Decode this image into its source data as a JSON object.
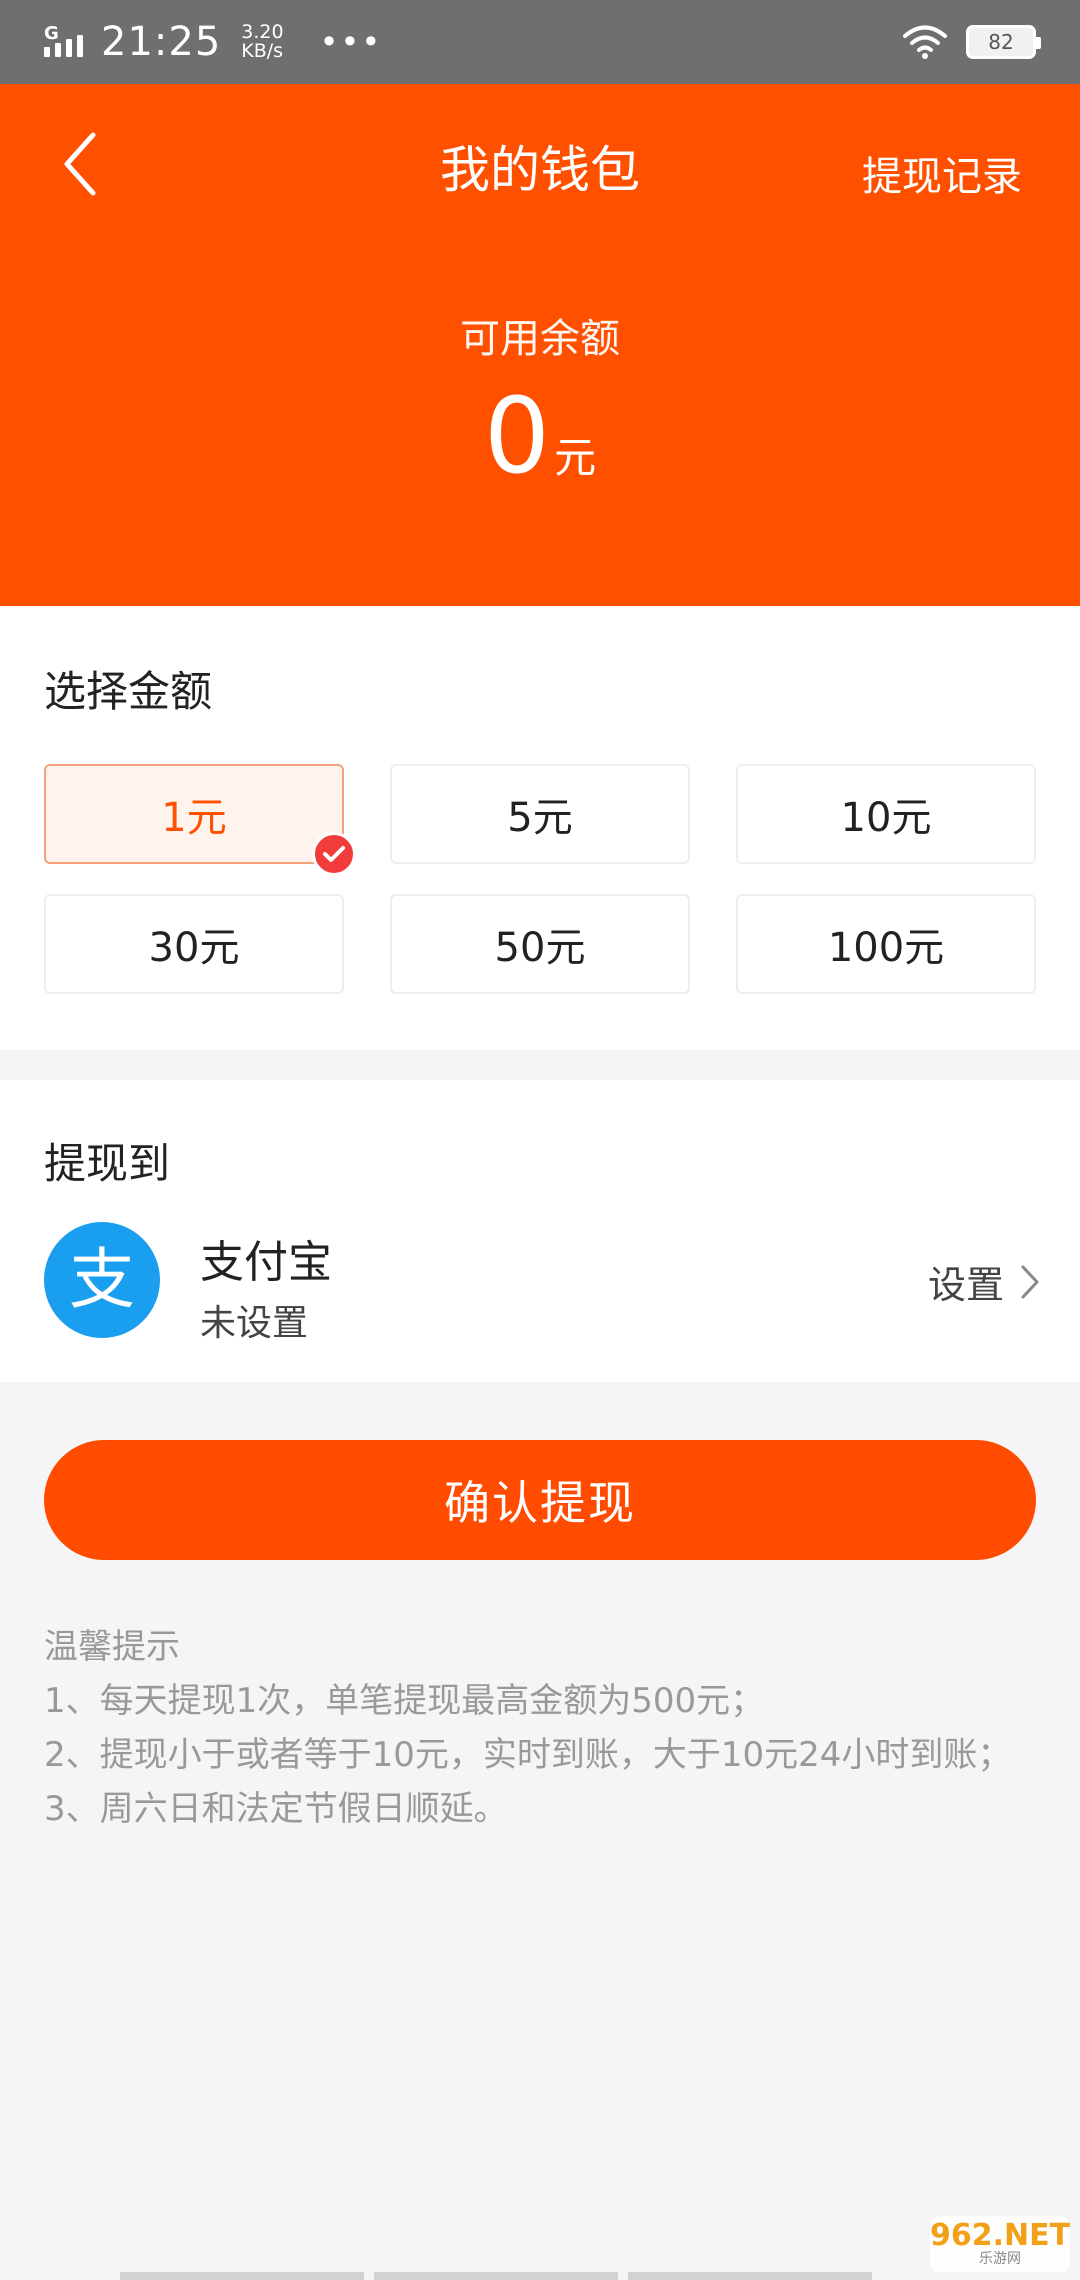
{
  "status_bar": {
    "network": "G",
    "time": "21:25",
    "speed_value": "3.20",
    "speed_unit": "KB/s",
    "more": "•••",
    "battery": "82"
  },
  "header": {
    "back_icon": "chevron-left-icon",
    "title": "我的钱包",
    "history_label": "提现记录",
    "balance_label": "可用余额",
    "balance_value": "0",
    "balance_unit": "元",
    "background_color": "#ff5000"
  },
  "amount": {
    "title": "选择金额",
    "options": [
      {
        "label": "1元",
        "selected": true
      },
      {
        "label": "5元",
        "selected": false
      },
      {
        "label": "10元",
        "selected": false
      },
      {
        "label": "30元",
        "selected": false
      },
      {
        "label": "50元",
        "selected": false
      },
      {
        "label": "100元",
        "selected": false
      }
    ],
    "selected_color": "#ff5000"
  },
  "withdraw": {
    "title": "提现到",
    "method_icon": "alipay-icon",
    "method_glyph": "支",
    "method_name": "支付宝",
    "method_status": "未设置",
    "setup_label": "设置",
    "alipay_color": "#1a9ff0"
  },
  "confirm": {
    "label": "确认提现",
    "color": "#ff4c00"
  },
  "tips": {
    "title": "温馨提示",
    "items": [
      "1、每天提现1次，单笔提现最高金额为500元；",
      "2、提现小于或者等于10元，实时到账，大于10元24小时到账；",
      "3、周六日和法定节假日顺延。"
    ]
  },
  "watermark": {
    "main": "962.NET",
    "sub": "乐游网"
  }
}
